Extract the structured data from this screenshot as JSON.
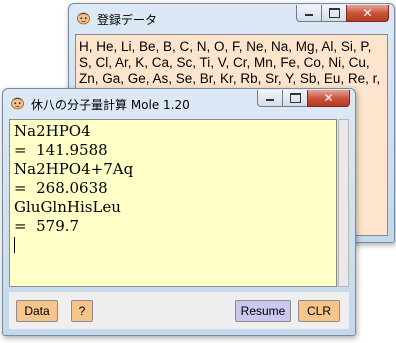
{
  "data_window": {
    "title": "登録データ",
    "text": "H, He, Li, Be, B, C, N, O, F, Ne, Na, Mg, Al, Si, P, S, Cl, Ar, K, Ca, Sc, Ti, V, Cr, Mn, Fe, Co, Ni, Cu, Zn, Ga, Ge, As, Se, Br, Kr, Rb, Sr, Y, Sb, Eu, Re, r, Ra, , Fm, Cys, Pro,"
  },
  "mole_window": {
    "title": "休八の分子量計算 Mole 1.20",
    "lines": [
      "Na2HPO4",
      "=  141.9588",
      "Na2HPO4+7Aq",
      "=  268.0638",
      "GluGlnHisLeu",
      "=  579.7"
    ],
    "buttons": {
      "data": "Data",
      "help": "?",
      "resume": "Resume",
      "clr": "CLR"
    }
  },
  "caption": {
    "close_glyph": "✕"
  },
  "colors": {
    "data_bg": "#fce5cc",
    "text_bg": "#ffffc8",
    "orange_button": "#f7c48c",
    "purple_button": "#c8c8f0",
    "close_red": "#c7503a"
  },
  "icons": {
    "app": "face-icon",
    "minimize": "minimize-icon",
    "maximize": "maximize-icon",
    "close": "close-icon"
  }
}
